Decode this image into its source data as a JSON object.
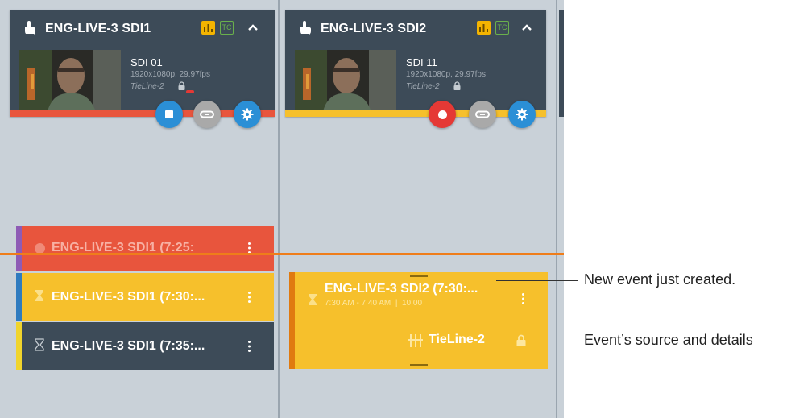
{
  "cards": [
    {
      "title": "ENG-LIVE-3 SDI1",
      "tc_badge": "TC",
      "source_name": "SDI 01",
      "source_format": "1920x1080p, 29.97fps",
      "tieline": "TieLine-2",
      "status_color": "#e8553d",
      "state": "recording"
    },
    {
      "title": "ENG-LIVE-3 SDI2",
      "tc_badge": "TC",
      "source_name": "SDI 11",
      "source_format": "1920x1080p, 29.97fps",
      "tieline": "TieLine-2",
      "status_color": "#f6c02c",
      "state": "idle"
    }
  ],
  "events_col1": [
    {
      "title": "ENG-LIVE-3 SDI1 (7:25:",
      "color": "#e8553d",
      "strip": "#8e5bb5",
      "icon": "circle-icon"
    },
    {
      "title": "ENG-LIVE-3 SDI1 (7:30:...",
      "color": "#f6c02c",
      "strip": "#2f7bbf",
      "icon": "hourglass-icon"
    },
    {
      "title": "ENG-LIVE-3 SDI1 (7:35:...",
      "color": "#3d4b58",
      "strip": "#f0d42c",
      "icon": "hourglass-outline-icon"
    }
  ],
  "new_event": {
    "title": "ENG-LIVE-3 SDI2 (7:30:...",
    "time": "7:30 AM - 7:40 AM  |  10:00",
    "source": "TieLine-2",
    "color": "#f6c02c",
    "strip": "#e07a10"
  },
  "callouts": {
    "new_event": "New event just created.",
    "source_details": "Event’s source and details"
  },
  "colors": {
    "now_line": "#ef7d1a",
    "stop_fab": "#2b8fd6",
    "record_fab": "#e53935",
    "link_fab": "#a9a9a9",
    "settings_fab": "#2b8fd6"
  }
}
